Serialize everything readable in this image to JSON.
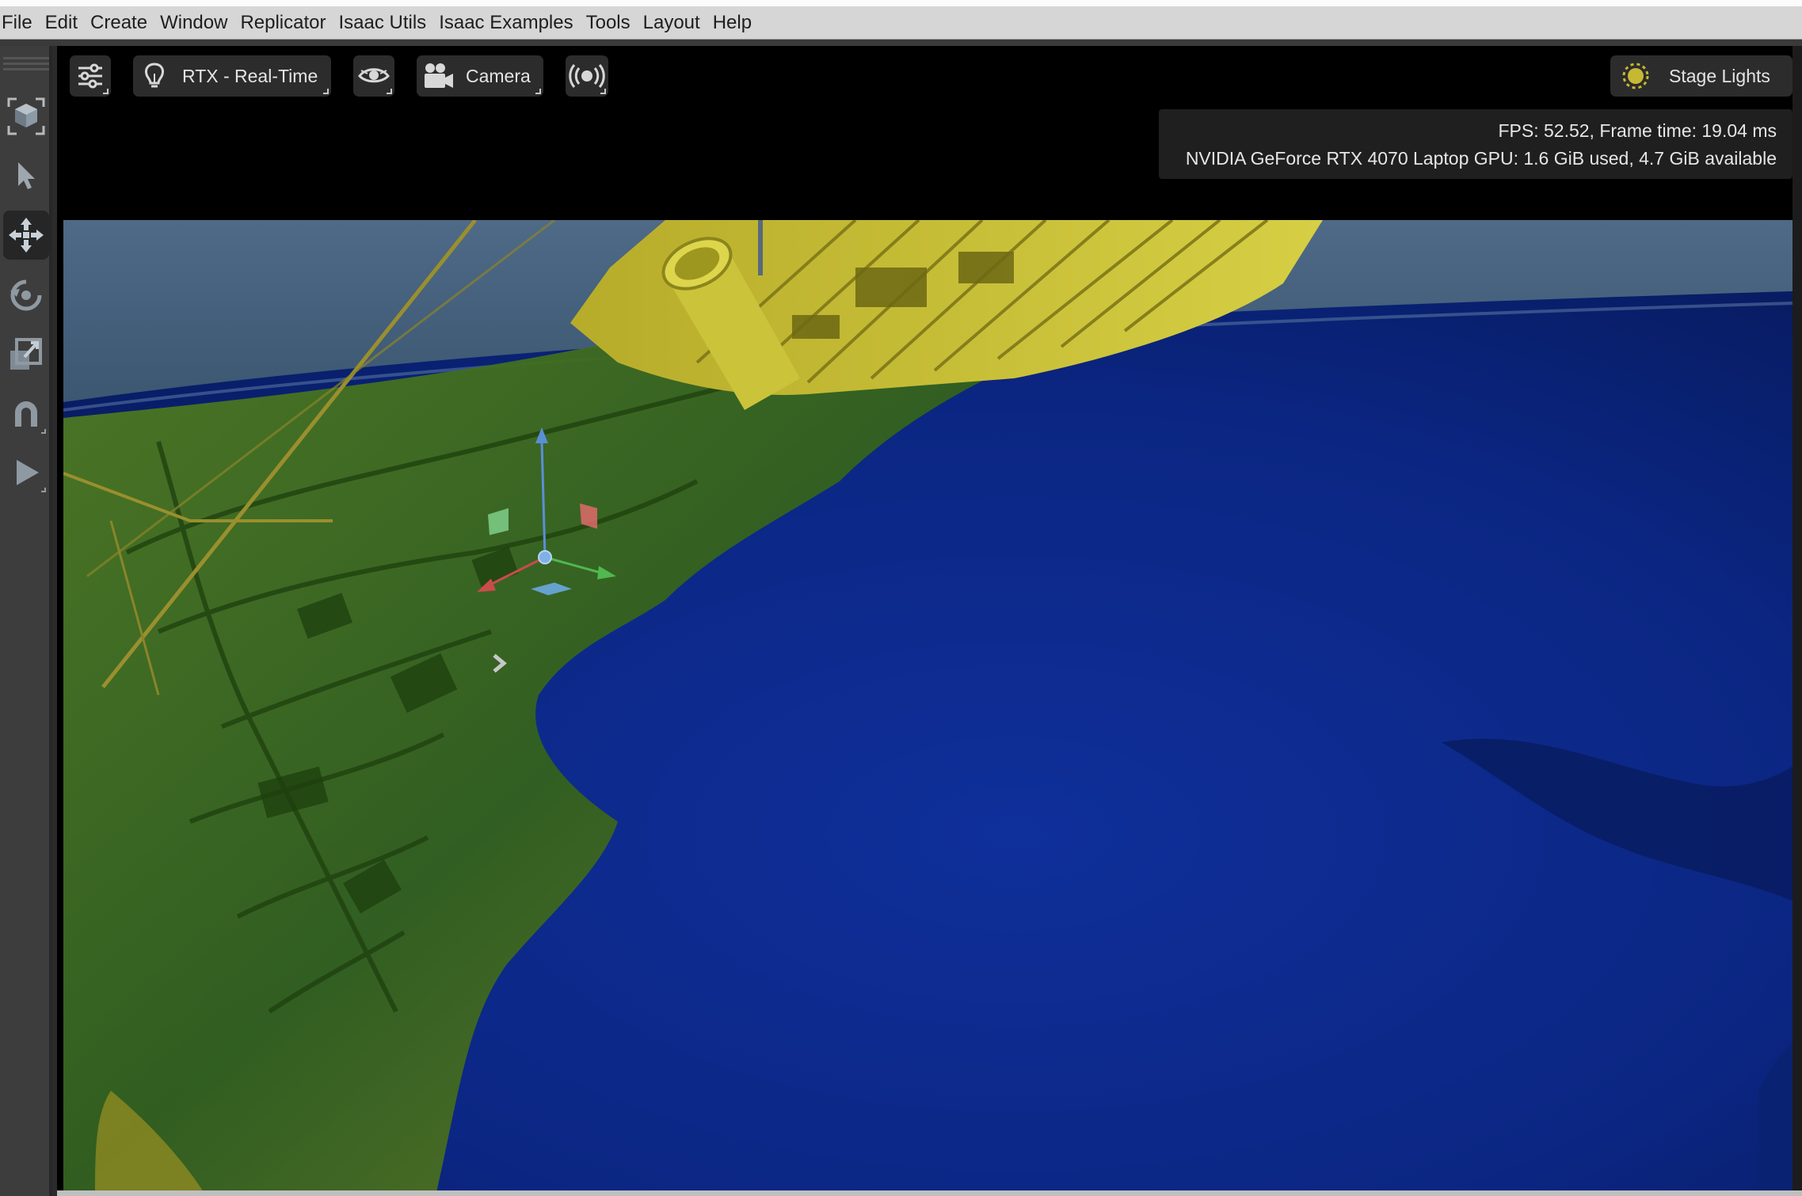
{
  "menu": [
    "File",
    "Edit",
    "Create",
    "Window",
    "Replicator",
    "Isaac Utils",
    "Isaac Examples",
    "Tools",
    "Layout",
    "Help"
  ],
  "tools": [
    {
      "name": "perspective-cube-icon",
      "active": false
    },
    {
      "name": "select-arrow-icon",
      "active": false
    },
    {
      "name": "move-icon",
      "active": true
    },
    {
      "name": "rotate-icon",
      "active": false
    },
    {
      "name": "scale-icon",
      "active": false
    },
    {
      "name": "snap-magnet-icon",
      "active": false
    },
    {
      "name": "play-icon",
      "active": false
    }
  ],
  "viewport_toolbar": {
    "settings_icon": "sliders-icon",
    "renderer_label": "RTX - Real-Time",
    "renderer_icon": "lightbulb-icon",
    "visibility_icon": "eye-icon",
    "camera_label": "Camera",
    "camera_icon": "camera-icon",
    "sensor_icon": "broadcast-icon",
    "lights_label": "Stage Lights",
    "lights_icon": "sun-icon"
  },
  "stats": {
    "line1": "FPS: 52.52, Frame time: 19.04 ms",
    "line2": "NVIDIA GeForce RTX 4070 Laptop GPU: 1.6 GiB used, 4.7 GiB available"
  },
  "colors": {
    "ocean": "#0d2a8a",
    "ship_hull": "#c9c23a",
    "seabed_green": "#3f6e1e",
    "gizmo_x": "#c94c4c",
    "gizmo_y": "#4fb84f",
    "gizmo_z": "#5a8fd6"
  }
}
